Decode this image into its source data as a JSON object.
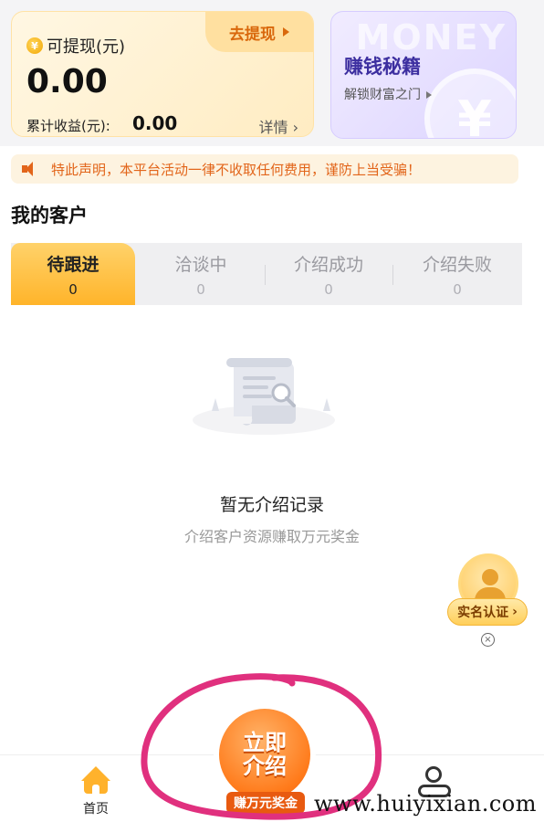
{
  "wallet": {
    "withdrawable_label": "可提现(元)",
    "withdrawable_amount": "0.00",
    "withdraw_button": "去提现",
    "cumulative_label": "累计收益(元):",
    "cumulative_value": "0.00",
    "details_link": "详情 ›",
    "coin_symbol": "¥"
  },
  "secrets_card": {
    "watermark": "MONEY",
    "title": "赚钱秘籍",
    "subtitle": "解锁财富之门",
    "yen": "¥"
  },
  "notice": {
    "text": "特此声明，本平台活动一律不收取任何费用，谨防上当受骗！"
  },
  "customers": {
    "title": "我的客户",
    "tabs": [
      {
        "label": "待跟进",
        "count": "0",
        "active": true
      },
      {
        "label": "洽谈中",
        "count": "0",
        "active": false
      },
      {
        "label": "介绍成功",
        "count": "0",
        "active": false
      },
      {
        "label": "介绍失败",
        "count": "0",
        "active": false
      }
    ],
    "empty": {
      "title": "暂无介绍记录",
      "subtitle": "介绍客户资源赚取万元奖金"
    }
  },
  "verify": {
    "label": "实名认证",
    "arrow": "›",
    "close": "×"
  },
  "bottom_nav": {
    "home_label": "首页",
    "intro_line1": "立即",
    "intro_line2": "介绍",
    "intro_tag": "赚万元奖金"
  },
  "watermark": "www.huiyixian.com",
  "colors": {
    "accent": "#ffb42a",
    "notice_text": "#e2651a",
    "annotation": "#e0307e"
  }
}
